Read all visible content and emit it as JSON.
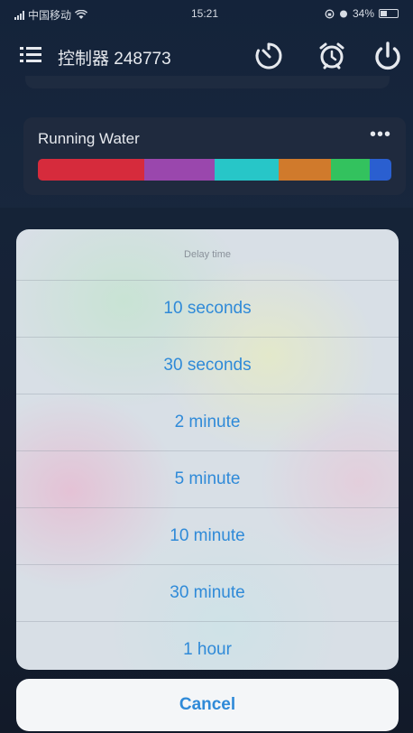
{
  "status_bar": {
    "carrier": "中国移动",
    "time": "15:21",
    "battery": "34%"
  },
  "header": {
    "title": "控制器 248773",
    "icons": [
      "menu-icon",
      "timer-icon",
      "alarm-icon",
      "power-icon"
    ]
  },
  "mode_card": {
    "name": "Running Water",
    "more": "•••",
    "colors": [
      "#d62b3c",
      "#9a47ad",
      "#27c6c8",
      "#d07a2c",
      "#33c25e",
      "#2a5fd0"
    ]
  },
  "sheet": {
    "title": "Delay time",
    "options": [
      "10 seconds",
      "30 seconds",
      "2 minute",
      "5 minute",
      "10 minute",
      "30 minute",
      "1 hour"
    ],
    "cancel": "Cancel"
  }
}
